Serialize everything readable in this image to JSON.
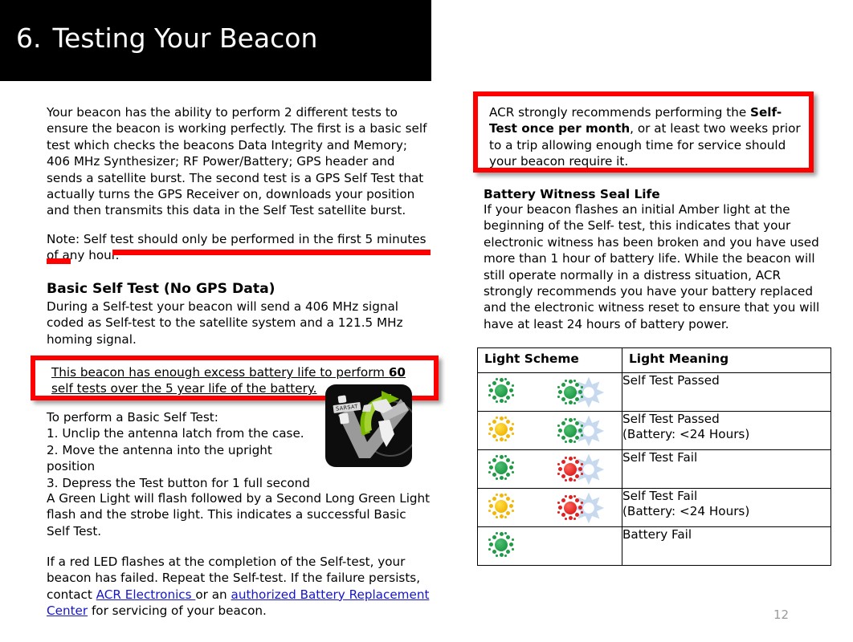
{
  "slide": {
    "number_label": "6.",
    "title": "Testing Your Beacon",
    "page_number": "12"
  },
  "colors": {
    "title_bar_bg": "#000000",
    "title_text": "#FFFFFF",
    "highlight_red": "#FF0000",
    "link_blue": "#1515C8",
    "lamp_green": "#1E9B44",
    "lamp_amber": "#F2B705",
    "lamp_red": "#E02020",
    "strobe_blue": "#C6D9EF",
    "page_number_grey": "#9A9A9A"
  },
  "left": {
    "intro_paragraph": "Your beacon has the ability to perform 2 different tests to ensure the beacon is working perfectly.  The first is a basic self test which checks the beacons Data Integrity and Memory; 406 MHz Synthesizer; RF Power/Battery; GPS header and sends a satellite burst.  The second test is a GPS Self Test that actually turns the GPS Receiver on, downloads your position and then transmits this data in the Self Test satellite burst.",
    "note_paragraph": "Note: Self test should only be performed in the first 5 minutes of any hour.",
    "basic_heading": "Basic Self Test (No GPS Data)",
    "basic_paragraph": "During a Self-test your beacon will send a 406 MHz signal coded as Self-test to the satellite system and a 121.5 MHz homing signal.",
    "callout_box": {
      "part1": "This beacon has enough excess battery life to perform ",
      "bold_number": "60",
      "part2": " self tests over the 5 year life of the battery."
    },
    "steps_intro": "To perform a Basic Self Test:",
    "steps": [
      "1. Unclip the antenna latch from the case.",
      "2. Move the antenna into the upright position",
      "3. Depress the Test button for 1 full second"
    ],
    "green_light_paragraph": "A Green Light will flash followed by a Second Long Green Light flash and the strobe light.  This indicates a successful Basic Self Test.",
    "failure_paragraph": {
      "part1": "If a red LED flashes at the completion of the Self-test, your beacon has failed. Repeat the Self-test. If the failure persists, contact ",
      "link1": "ACR Electronics ",
      "part2": "or an ",
      "link2": "authorized Battery Replacement Center",
      "part3": " for servicing of your beacon."
    },
    "logo": {
      "name": "sarsat-logo",
      "label": "SARSAT"
    }
  },
  "right": {
    "callout_box": {
      "part1": "ACR strongly recommends performing the ",
      "bold1": "Self-Test once per month",
      "part2": ", or at least two weeks prior to a trip allowing enough time for service should your beacon require it."
    },
    "battery_heading": "Battery Witness Seal Life",
    "battery_paragraph": "If your beacon flashes an initial Amber light at the beginning of the Self- test, this indicates that your electronic witness has been broken and you have used more than 1 hour of battery life. While the beacon will still operate normally in a distress situation, ACR strongly recommends you have your battery replaced and the electronic witness reset to ensure that you will have at least 24 hours of battery power.",
    "table": {
      "headers": [
        "Light Scheme",
        "Light Meaning"
      ],
      "rows": [
        {
          "lamp1": "green",
          "lamp2": "green",
          "strobe": true,
          "meaning": "Self Test Passed"
        },
        {
          "lamp1": "amber",
          "lamp2": "green",
          "strobe": true,
          "meaning": "Self Test Passed\n(Battery: <24 Hours)"
        },
        {
          "lamp1": "green",
          "lamp2": "red",
          "strobe": true,
          "meaning": "Self Test Fail"
        },
        {
          "lamp1": "amber",
          "lamp2": "red",
          "strobe": true,
          "meaning": "Self Test Fail\n(Battery: <24 Hours)"
        },
        {
          "lamp1": "green",
          "lamp2": null,
          "strobe": false,
          "meaning": "Battery Fail"
        }
      ]
    }
  }
}
